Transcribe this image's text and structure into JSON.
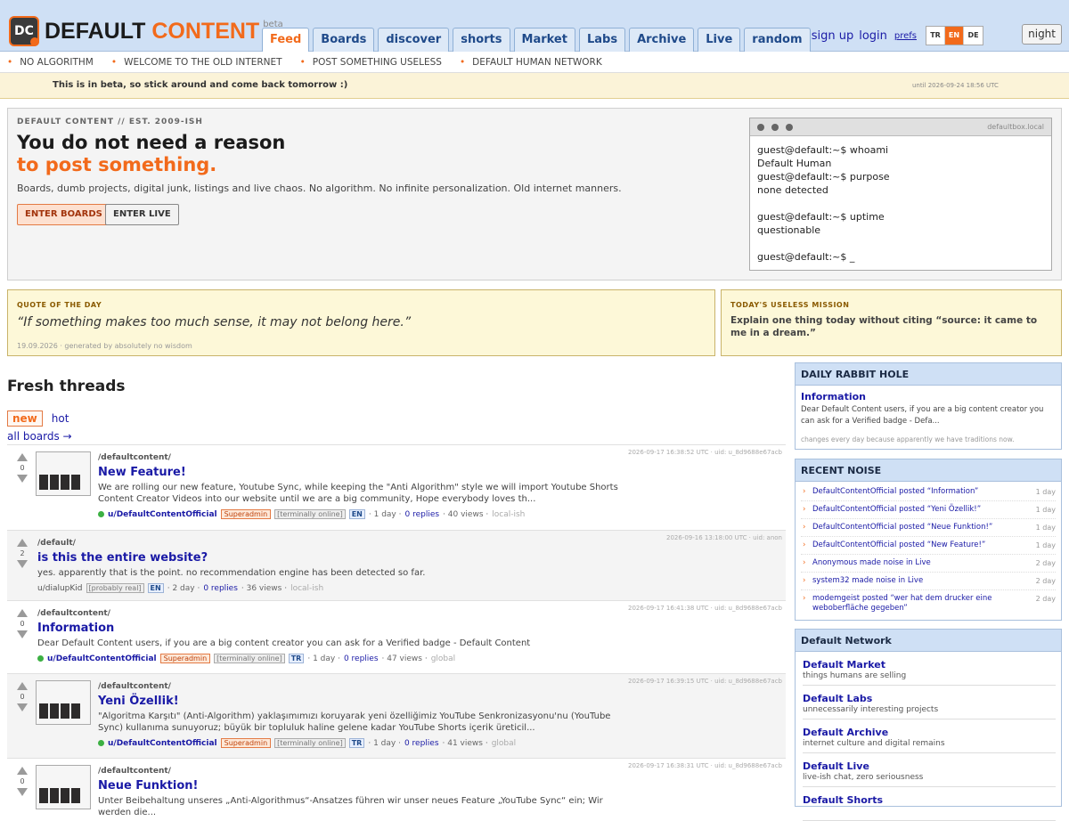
{
  "header": {
    "logo_badge": "DC",
    "logo_word1": "DEFAULT",
    "logo_word2": "CONTENT",
    "beta": "beta",
    "tabs": [
      "Feed",
      "Boards",
      "discover",
      "shorts",
      "Market",
      "Labs",
      "Archive",
      "Live",
      "random"
    ],
    "signup": "sign up",
    "login": "login",
    "prefs": "prefs",
    "langs": [
      "TR",
      "EN",
      "DE"
    ],
    "active_lang": "EN",
    "night": "night",
    "accent": "#f26a1b"
  },
  "slogans": [
    "NO ALGORITHM",
    "WELCOME TO THE OLD INTERNET",
    "POST SOMETHING USELESS",
    "DEFAULT HUMAN NETWORK"
  ],
  "beta_bar": {
    "message": "This is in beta, so stick around and come back tomorrow :)",
    "until": "until 2026-09-24 18:56 UTC"
  },
  "hero": {
    "kicker": "DEFAULT CONTENT // EST. 2009-ISH",
    "title_line1": "You do not need a reason",
    "title_line2": "to post something.",
    "description": "Boards, dumb projects, digital junk, listings and live chaos. No algorithm. No infinite personalization. Old internet manners.",
    "btn_boards": "ENTER BOARDS",
    "btn_live": "ENTER LIVE",
    "terminal_host": "defaultbox.local",
    "terminal_lines": [
      "guest@default:~$ whoami",
      "Default Human",
      "guest@default:~$ purpose",
      "none detected",
      "",
      "guest@default:~$ uptime",
      "questionable",
      "",
      "guest@default:~$ _"
    ]
  },
  "quote": {
    "title": "QUOTE OF THE DAY",
    "text": "“If something makes too much sense, it may not belong here.”",
    "meta": "19.09.2026 · generated by absolutely no wisdom"
  },
  "mission": {
    "title": "TODAY'S USELESS MISSION",
    "text": "Explain one thing today without citing “source: it came to me in a dream.”"
  },
  "threads_section": {
    "title": "Fresh threads",
    "sort_new": "new",
    "sort_hot": "hot",
    "all_boards": "all boards →"
  },
  "threads": [
    {
      "board": "/defaultcontent/",
      "title": "New Feature!",
      "snippet": "We are rolling our new feature, Youtube Sync, while keeping the \"Anti Algorithm\" style we will import Youtube Shorts Content Creator Videos into our website until we are a big community, Hope everybody loves th...",
      "user": "u/DefaultContentOfficial",
      "role": "Superadmin",
      "status": "[terminally online]",
      "lang": "EN",
      "age": "· 1 day ·",
      "replies": "0 replies",
      "views": "· 40 views ·",
      "scope": "local-ish",
      "score": "0",
      "stamp": "2026-09-17 16:38:52 UTC · uid: u_8d9688e67acb"
    },
    {
      "board": "/default/",
      "title": "is this the entire website?",
      "snippet": "yes. apparently that is the point. no recommendation engine has been detected so far.",
      "user": "u/dialupKid",
      "role": "",
      "status": "[probably real]",
      "lang": "EN",
      "age": "· 2 day ·",
      "replies": "0 replies",
      "views": "· 36 views ·",
      "scope": "local-ish",
      "score": "2",
      "stamp": "2026-09-16 13:18:00 UTC · uid: anon"
    },
    {
      "board": "/defaultcontent/",
      "title": "Information",
      "snippet": "Dear Default Content users, if you are a big content creator you can ask for a Verified badge - Default Content",
      "user": "u/DefaultContentOfficial",
      "role": "Superadmin",
      "status": "[terminally online]",
      "lang": "TR",
      "age": "· 1 day ·",
      "replies": "0 replies",
      "views": "· 47 views ·",
      "scope": "global",
      "score": "0",
      "stamp": "2026-09-17 16:41:38 UTC · uid: u_8d9688e67acb"
    },
    {
      "board": "/defaultcontent/",
      "title": "Yeni Özellik!",
      "snippet": "\"Algoritma Karşıtı\" (Anti-Algorithm) yaklaşımımızı koruyarak yeni özelliğimiz YouTube Senkronizasyonu'nu (YouTube Sync) kullanıma sunuyoruz; büyük bir topluluk haline gelene kadar YouTube Shorts içerik üreticil...",
      "user": "u/DefaultContentOfficial",
      "role": "Superadmin",
      "status": "[terminally online]",
      "lang": "TR",
      "age": "· 1 day ·",
      "replies": "0 replies",
      "views": "· 41 views ·",
      "scope": "global",
      "score": "0",
      "stamp": "2026-09-17 16:39:15 UTC · uid: u_8d9688e67acb"
    },
    {
      "board": "/defaultcontent/",
      "title": "Neue Funktion!",
      "snippet": "Unter Beibehaltung unseres „Anti-Algorithmus“-Ansatzes führen wir unser neues Feature „YouTube Sync“ ein; Wir werden die...",
      "score": "0",
      "stamp": "2026-09-17 16:38:31 UTC · uid: u_8d9688e67acb"
    }
  ],
  "rabbit_hole": {
    "title": "DAILY RABBIT HOLE",
    "item_title": "Information",
    "item_desc": "Dear Default Content users, if you are a big content creator you can ask for a Verified badge - Defa...",
    "footer": "changes every day because apparently we have traditions now."
  },
  "recent_noise": {
    "title": "RECENT NOISE",
    "items": [
      {
        "text": "DefaultContentOfficial posted “Information”",
        "ago": "1 day"
      },
      {
        "text": "DefaultContentOfficial posted “Yeni Özellik!”",
        "ago": "1 day"
      },
      {
        "text": "DefaultContentOfficial posted “Neue Funktion!”",
        "ago": "1 day"
      },
      {
        "text": "DefaultContentOfficial posted “New Feature!”",
        "ago": "1 day"
      },
      {
        "text": "Anonymous made noise in Live",
        "ago": "2 day"
      },
      {
        "text": "system32 made noise in Live",
        "ago": "2 day"
      },
      {
        "text": "modemgeist posted “wer hat dem drucker eine weboberfläche gegeben”",
        "ago": "2 day"
      }
    ]
  },
  "network": {
    "title": "Default Network",
    "items": [
      {
        "name": "Default Market",
        "desc": "things humans are selling"
      },
      {
        "name": "Default Labs",
        "desc": "unnecessarily interesting projects"
      },
      {
        "name": "Default Archive",
        "desc": "internet culture and digital remains"
      },
      {
        "name": "Default Live",
        "desc": "live-ish chat, zero seriousness"
      },
      {
        "name": "Default Shorts",
        "desc": ""
      }
    ]
  }
}
